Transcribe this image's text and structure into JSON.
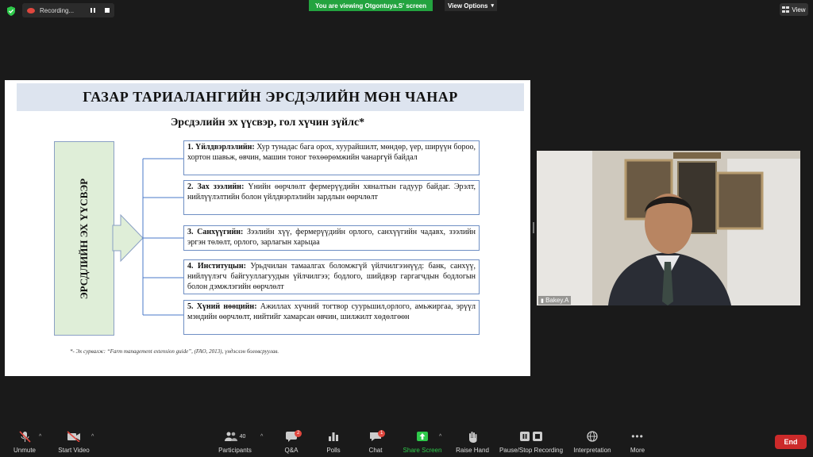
{
  "meeting": {
    "recording_label": "Recording...",
    "viewing_banner": "You are viewing Otgontuya.S' screen",
    "view_options": "View Options",
    "view_button": "View"
  },
  "slide": {
    "title": "ГАЗАР ТАРИАЛАНГИЙН ЭРСДЭЛИЙН МӨН ЧАНАР",
    "subtitle": "Эрсдэлийн эх үүсвэр, гол хүчин зүйлс*",
    "left_box": "ЭРСДЛИЙН ЭХ ҮҮСВЭР",
    "items": [
      {
        "head": "1.  Үйлдвэрлэлийн:",
        "text": " Хур тунадас бага орох, хуурайшилт, мөндөр, үер, ширүүн бороо, хортон шавьж, өвчин, машин тоног төхөөрөмжийн чанаргүй байдал"
      },
      {
        "head": "2.  Зах зээлийн:",
        "text": " Үнийн өөрчлөлт фермерүүдийн хяналтын гадуур байдаг. Эрэлт, нийлүүлэлтийн болон үйлдвэрлэлийн зардлын өөрчлөлт"
      },
      {
        "head": "3.  Санхүүгийн:",
        "text": " Зээлийн хүү, фермерүүдийн орлого, санхүүгийн чадавх, зээлийн эргэн төлөлт, орлого, зарлагын харьцаа"
      },
      {
        "head": "4.  Институцын:",
        "text": " Урьдчилан тамаалгах боломжгүй үйлчилгээнүүд: банк, санхүү, нийлүүлэгч байгууллагуудын үйлчилгээ; бодлого, шийдвэр гаргагчдын бодлогын болон дэмжлэгийн өөрчлөлт"
      },
      {
        "head": "5.  Хүний нөөцийн:",
        "text": " Ажиллах хүчний тогтвор суурьшил,орлого, амьжиргаа, эрүүл мэндийн өөрчлөлт, нийтийг хамарсан өвчин, шилжилт хөдөлгөөн"
      }
    ],
    "footnote": "*- Эх сурвалж: “Farm management extension guide”, (FAO, 2013), үндэслэн боловсруулав."
  },
  "participant": {
    "name": "Bakey.A"
  },
  "toolbar": {
    "unmute": "Unmute",
    "start_video": "Start Video",
    "participants": "Participants",
    "participants_count": "40",
    "qa": "Q&A",
    "qa_badge": "2",
    "polls": "Polls",
    "chat": "Chat",
    "chat_badge": "1",
    "share_screen": "Share Screen",
    "raise_hand": "Raise Hand",
    "pause_stop": "Pause/Stop Recording",
    "interpretation": "Interpretation",
    "more": "More",
    "end": "End"
  },
  "colors": {
    "banner_green": "#23a33f",
    "end_red": "#cc2a2a",
    "share_green": "#2ec94a"
  }
}
